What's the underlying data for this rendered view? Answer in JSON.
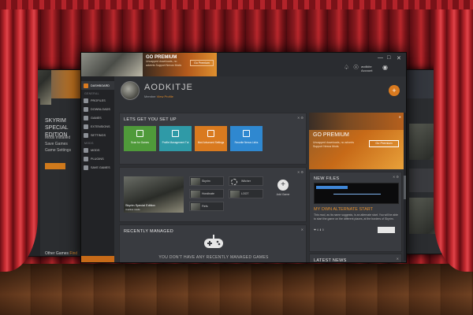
{
  "colors": {
    "accent": "#d97a1f",
    "panel": "#393b40",
    "sidebar": "#222326",
    "curtain": "#b9272c"
  },
  "titlebar": {
    "banner_title": "GO PREMIUM",
    "banner_sub": "Uncapped downloads, no adverts Support Nexus Mods",
    "banner_button": "Go Premium",
    "user": "avdikite",
    "user_sub": "Account",
    "bell_icon": "bell-icon",
    "window_controls": [
      "—",
      "□",
      "✕"
    ]
  },
  "sidebar": {
    "items_top": [
      {
        "label": "DASHBOARD",
        "icon": "dashboard-icon",
        "active": true
      }
    ],
    "section_general": "GENERAL",
    "items_general": [
      {
        "label": "PROFILES",
        "icon": "profiles-icon"
      },
      {
        "label": "DOWNLOADS",
        "icon": "downloads-icon"
      },
      {
        "label": "GAMES",
        "icon": "games-icon"
      },
      {
        "label": "EXTENSIONS",
        "icon": "extensions-icon"
      },
      {
        "label": "SETTINGS",
        "icon": "settings-icon"
      }
    ],
    "section_mods": "MODS",
    "items_mods": [
      {
        "label": "MODS",
        "icon": "mods-icon"
      },
      {
        "label": "PLUGINS",
        "icon": "plugins-icon"
      },
      {
        "label": "SAVE GAMES",
        "icon": "save-games-icon"
      }
    ]
  },
  "header": {
    "name": "AODKITJE",
    "role": "Member",
    "role_link": "View Profile",
    "add_label": "+"
  },
  "setup": {
    "title": "LETS GET YOU SET UP",
    "tiles": [
      {
        "label": "Scan for Games",
        "color": "#4f9a3a"
      },
      {
        "label": "Profile Management Tut",
        "color": "#2f9aa7"
      },
      {
        "label": "Mod Advanced Settings",
        "color": "#d97a1f"
      },
      {
        "label": "Favorite Nexus Links",
        "color": "#2f88d0"
      }
    ]
  },
  "premium": {
    "title": "GO PREMIUM",
    "sub": "Uncapped downloads, no adverts Support Nexus Mods",
    "button": "Go Premium"
  },
  "games": {
    "cover_title": "Skyrim Special Edition",
    "cover_sub": "4 active mods",
    "slots": [
      "Skyrim",
      "Witcher",
      "Hondinate",
      "LOOT",
      "Fiefs"
    ],
    "add_label": "Add Game",
    "add_icon": "+"
  },
  "recent": {
    "title": "RECENTLY MANAGED",
    "empty": "YOU DON'T HAVE ANY RECENTLY MANAGED GAMES"
  },
  "new_files": {
    "title": "NEW FILES",
    "file_title": "MY OWN ALTERNATE START",
    "desc": "This mod, as its name suggests, is an alternate start. You will be able to start the game on the different places, at the borders of Skyrim.",
    "meta": "❤ 4  ⬇ 0"
  },
  "latest": {
    "title": "LATEST NEWS"
  },
  "bg_left": {
    "game": "SKYRIM SPECIAL EDITION",
    "lines": [
      "Mods Installed",
      "Save Games",
      "Game Settings"
    ],
    "play": "PLAY",
    "other": "Other Games",
    "other_link": "Find"
  }
}
